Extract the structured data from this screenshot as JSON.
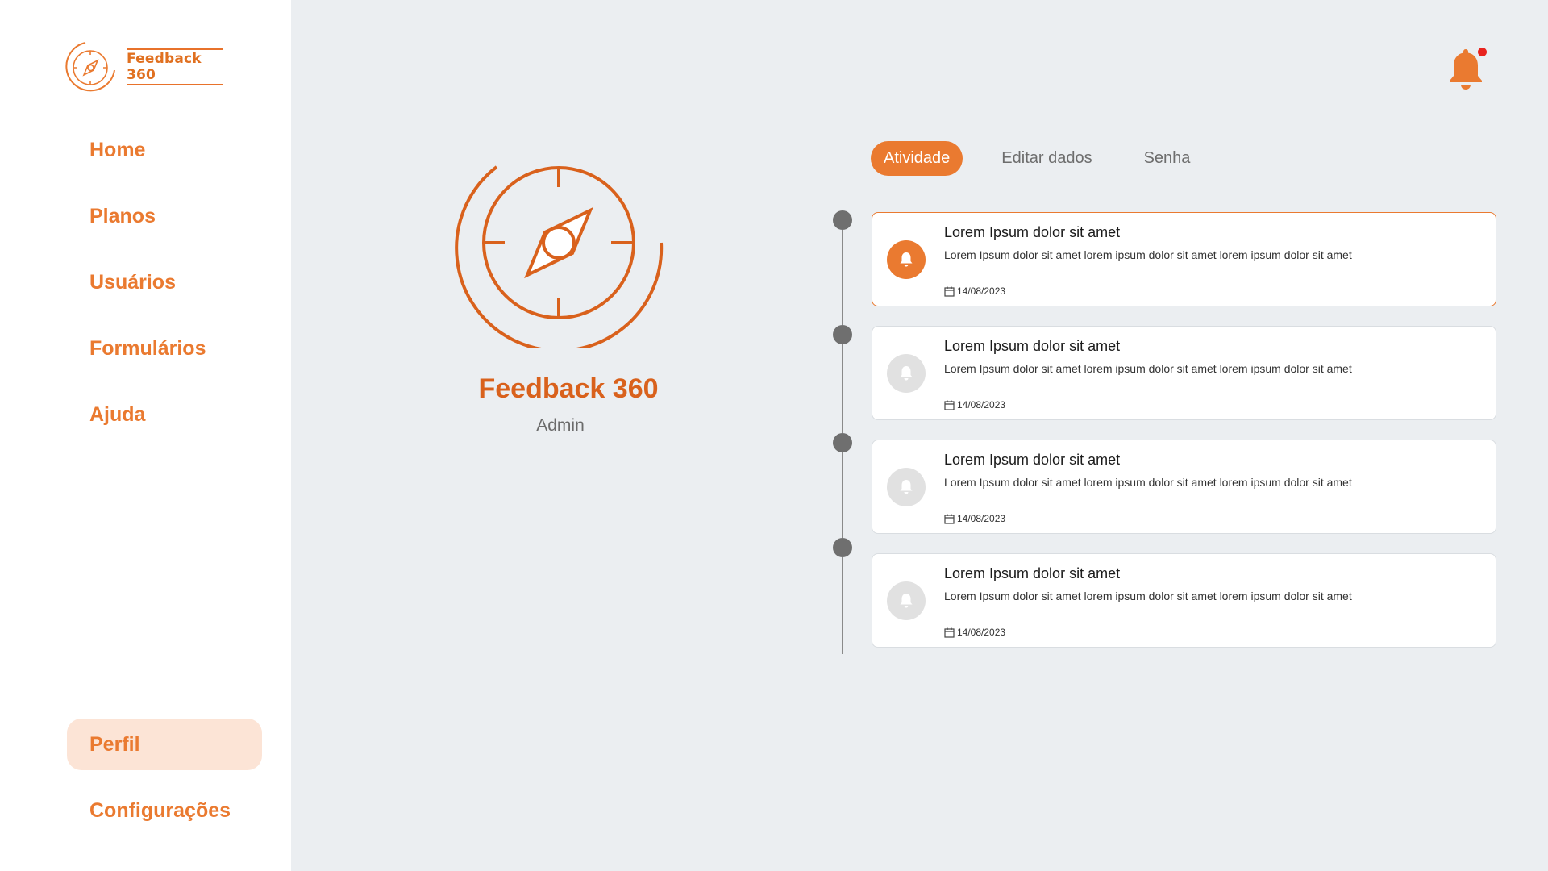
{
  "brand": {
    "logo_text": "Feedback 360",
    "accent_color": "#ea7a30",
    "accent_dark": "#d9611c",
    "active_bg": "#fce4d6"
  },
  "sidebar": {
    "items": [
      {
        "label": "Home"
      },
      {
        "label": "Planos"
      },
      {
        "label": "Usuários"
      },
      {
        "label": "Formulários"
      },
      {
        "label": "Ajuda"
      }
    ],
    "bottom_items": [
      {
        "label": "Perfil",
        "active": true
      },
      {
        "label": "Configurações"
      }
    ]
  },
  "header": {
    "notification_icon": "bell-icon",
    "has_unread": true
  },
  "profile": {
    "name": "Feedback 360",
    "role": "Admin"
  },
  "tabs": [
    {
      "label": "Atividade",
      "active": true
    },
    {
      "label": "Editar dados"
    },
    {
      "label": "Senha"
    }
  ],
  "activities": [
    {
      "title": "Lorem Ipsum dolor sit amet",
      "body": "Lorem Ipsum dolor sit amet lorem ipsum dolor sit amet lorem ipsum dolor sit amet",
      "date": "14/08/2023",
      "active": true
    },
    {
      "title": "Lorem Ipsum dolor sit amet",
      "body": "Lorem Ipsum dolor sit amet lorem ipsum dolor sit amet lorem ipsum dolor sit amet",
      "date": "14/08/2023"
    },
    {
      "title": "Lorem Ipsum dolor sit amet",
      "body": "Lorem Ipsum dolor sit amet lorem ipsum dolor sit amet lorem ipsum dolor sit amet",
      "date": "14/08/2023"
    },
    {
      "title": "Lorem Ipsum dolor sit amet",
      "body": "Lorem Ipsum dolor sit amet lorem ipsum dolor sit amet lorem ipsum dolor sit amet",
      "date": "14/08/2023"
    }
  ]
}
